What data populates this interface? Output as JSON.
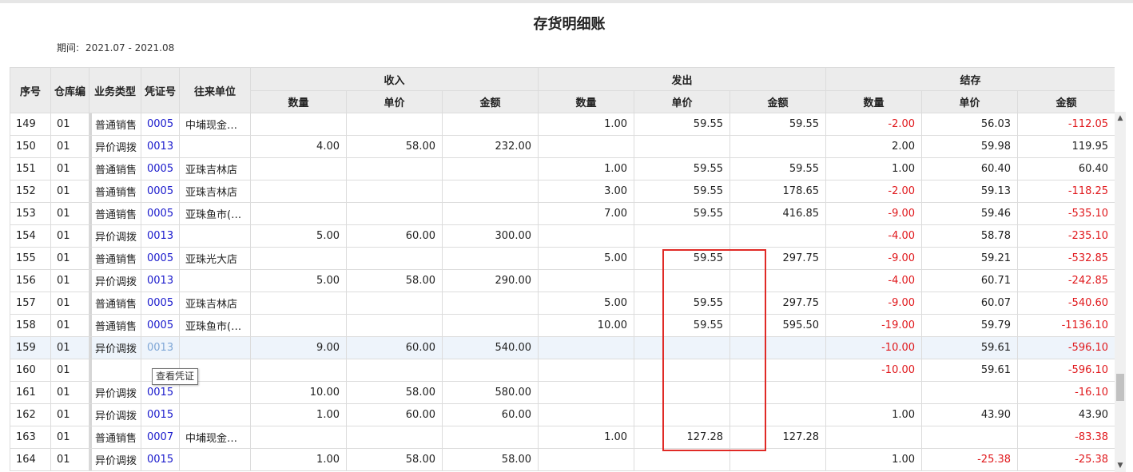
{
  "title": "存货明细账",
  "period": {
    "label": "期间:",
    "value": "2021.07 - 2021.08"
  },
  "header": {
    "cols": [
      "序号",
      "仓库编",
      "业务类型",
      "凭证号",
      "往来单位"
    ],
    "groups": [
      "收入",
      "发出",
      "结存"
    ],
    "sub": [
      "数量",
      "单价",
      "金额"
    ]
  },
  "rows": [
    [
      "149",
      "01",
      "普通销售",
      "0005",
      "中埔现金…",
      "",
      "",
      "",
      "1.00",
      "59.55",
      "59.55",
      "-2.00",
      "56.03",
      "-112.05"
    ],
    [
      "150",
      "01",
      "异价调拨",
      "0013",
      "",
      "4.00",
      "58.00",
      "232.00",
      "",
      "",
      "",
      "2.00",
      "59.98",
      "119.95"
    ],
    [
      "151",
      "01",
      "普通销售",
      "0005",
      "亚珠吉林店",
      "",
      "",
      "",
      "1.00",
      "59.55",
      "59.55",
      "1.00",
      "60.40",
      "60.40"
    ],
    [
      "152",
      "01",
      "普通销售",
      "0005",
      "亚珠吉林店",
      "",
      "",
      "",
      "3.00",
      "59.55",
      "178.65",
      "-2.00",
      "59.13",
      "-118.25"
    ],
    [
      "153",
      "01",
      "普通销售",
      "0005",
      "亚珠鱼市(…",
      "",
      "",
      "",
      "7.00",
      "59.55",
      "416.85",
      "-9.00",
      "59.46",
      "-535.10"
    ],
    [
      "154",
      "01",
      "异价调拨",
      "0013",
      "",
      "5.00",
      "60.00",
      "300.00",
      "",
      "",
      "",
      "-4.00",
      "58.78",
      "-235.10"
    ],
    [
      "155",
      "01",
      "普通销售",
      "0005",
      "亚珠光大店",
      "",
      "",
      "",
      "5.00",
      "59.55",
      "297.75",
      "-9.00",
      "59.21",
      "-532.85"
    ],
    [
      "156",
      "01",
      "异价调拨",
      "0013",
      "",
      "5.00",
      "58.00",
      "290.00",
      "",
      "",
      "",
      "-4.00",
      "60.71",
      "-242.85"
    ],
    [
      "157",
      "01",
      "普通销售",
      "0005",
      "亚珠吉林店",
      "",
      "",
      "",
      "5.00",
      "59.55",
      "297.75",
      "-9.00",
      "60.07",
      "-540.60"
    ],
    [
      "158",
      "01",
      "普通销售",
      "0005",
      "亚珠鱼市(…",
      "",
      "",
      "",
      "10.00",
      "59.55",
      "595.50",
      "-19.00",
      "59.79",
      "-1136.10"
    ],
    [
      "159",
      "01",
      "异价调拨",
      "0013",
      "",
      "9.00",
      "60.00",
      "540.00",
      "",
      "",
      "",
      "-10.00",
      "59.61",
      "-596.10"
    ],
    [
      "160",
      "01",
      "",
      "",
      "",
      "",
      "",
      "",
      "",
      "",
      "",
      "-10.00",
      "59.61",
      "-596.10"
    ],
    [
      "161",
      "01",
      "异价调拨",
      "0015",
      "",
      "10.00",
      "58.00",
      "580.00",
      "",
      "",
      "",
      "",
      "",
      "-16.10"
    ],
    [
      "162",
      "01",
      "异价调拨",
      "0015",
      "",
      "1.00",
      "60.00",
      "60.00",
      "",
      "",
      "",
      "1.00",
      "43.90",
      "43.90"
    ],
    [
      "163",
      "01",
      "普通销售",
      "0007",
      "中埔现金…",
      "",
      "",
      "",
      "1.00",
      "127.28",
      "127.28",
      "",
      "",
      "-83.38"
    ],
    [
      "164",
      "01",
      "异价调拨",
      "0015",
      "",
      "1.00",
      "58.00",
      "58.00",
      "",
      "",
      "",
      "1.00",
      "-25.38",
      "-25.38"
    ]
  ],
  "tooltip": "查看凭证",
  "colors": {
    "negative": "#e0181c",
    "voucher_link": "#1a1acc",
    "header_bg": "#ececec",
    "annotation": "#e02a26"
  }
}
